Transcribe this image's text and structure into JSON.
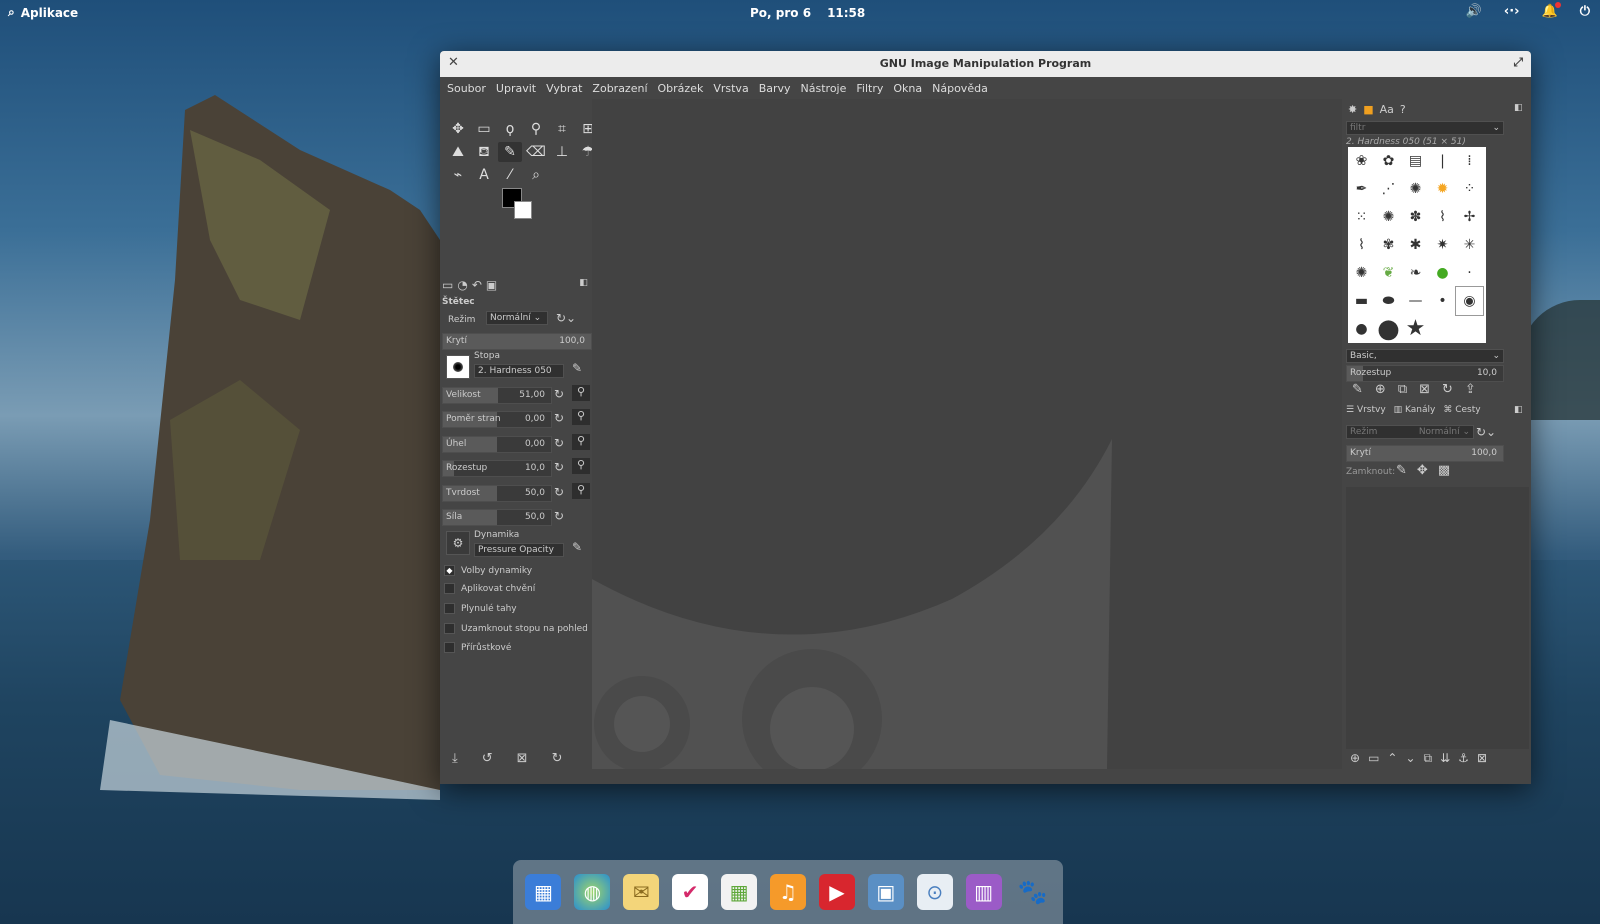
{
  "topbar": {
    "apps_label": "Aplikace",
    "date": "Po, pro 6",
    "time": "11:58"
  },
  "window": {
    "title": "GNU Image Manipulation Program"
  },
  "menu": [
    "Soubor",
    "Upravit",
    "Vybrat",
    "Zobrazení",
    "Obrázek",
    "Vrstva",
    "Barvy",
    "Nástroje",
    "Filtry",
    "Okna",
    "Nápověda"
  ],
  "tool_options": {
    "title": "Štětec",
    "mode_label": "Režim",
    "mode_value": "Normální",
    "opacity_label": "Krytí",
    "opacity_value": "100,0",
    "brush_label": "Stopa",
    "brush_value": "2. Hardness 050",
    "sliders": [
      {
        "label": "Velikost",
        "value": "51,00",
        "fill": 0.51
      },
      {
        "label": "Poměr stran",
        "value": "0,00",
        "fill": 0.5
      },
      {
        "label": "Úhel",
        "value": "0,00",
        "fill": 0.5
      },
      {
        "label": "Rozestup",
        "value": "10,0",
        "fill": 0.1
      },
      {
        "label": "Tvrdost",
        "value": "50,0",
        "fill": 0.5
      },
      {
        "label": "Síla",
        "value": "50,0",
        "fill": 0.5
      }
    ],
    "dynamics_label": "Dynamika",
    "dynamics_value": "Pressure Opacity",
    "checkboxes": [
      {
        "label": "Volby dynamiky",
        "checked": true
      },
      {
        "label": "Aplikovat chvění",
        "checked": false
      },
      {
        "label": "Plynulé tahy",
        "checked": false
      },
      {
        "label": "Uzamknout stopu na pohled",
        "checked": false
      },
      {
        "label": "Přírůstkové",
        "checked": false
      }
    ]
  },
  "brushes_panel": {
    "filter_placeholder": "filtr",
    "current_brush": "2. Hardness 050 (51 × 51)",
    "tag": "Basic,",
    "spacing_label": "Rozestup",
    "spacing_value": "10,0"
  },
  "layers_panel": {
    "tabs": [
      "Vrstvy",
      "Kanály",
      "Cesty"
    ],
    "mode_label": "Režim",
    "mode_value": "Normální",
    "opacity_label": "Krytí",
    "opacity_value": "100,0",
    "lock_label": "Zamknout:"
  },
  "dock_apps": [
    "multitasking-view",
    "web-browser",
    "mail",
    "tasks",
    "calendar",
    "music",
    "videos",
    "photos",
    "settings",
    "appcenter",
    "gimp"
  ],
  "colors": {
    "accent": "#4a90d9",
    "window_bg": "#454545",
    "canvas_bg": "#424242"
  }
}
